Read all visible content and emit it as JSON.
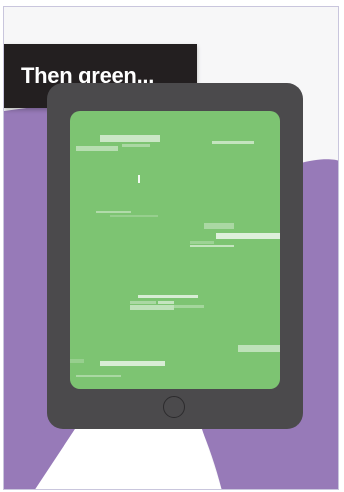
{
  "caption": {
    "text": "Then green..."
  },
  "colors": {
    "background": "#f7f7f8",
    "purple_shape": "#977ab8",
    "caption_bg": "#231f20",
    "caption_text": "#ffffff",
    "tablet_body": "#4b4a4c",
    "screen_green": "#7dc472",
    "home_button_ring": "#2c2b2d"
  },
  "screen": {
    "state": "green",
    "effect": "glitch-lines"
  }
}
